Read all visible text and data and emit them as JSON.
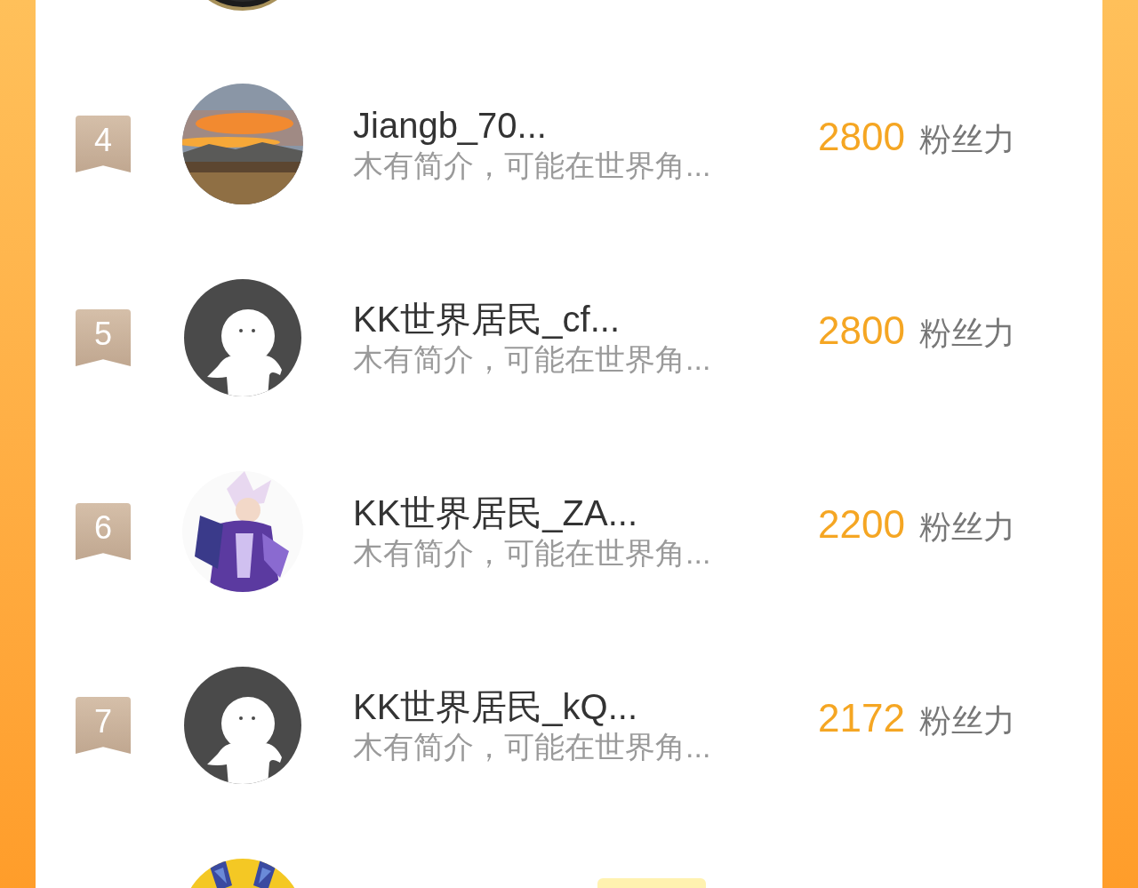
{
  "rows": [
    {
      "avatar": {
        "kind": "medal"
      }
    },
    {
      "rank": "4",
      "avatar": {
        "kind": "landscape"
      },
      "name": "Jiangb_70...",
      "intro": "木有简介，可能在世界角...",
      "score": "2800",
      "unit": "粉丝力"
    },
    {
      "rank": "5",
      "avatar": {
        "kind": "default"
      },
      "name": "KK世界居民_cf...",
      "intro": "木有简介，可能在世界角...",
      "score": "2800",
      "unit": "粉丝力"
    },
    {
      "rank": "6",
      "avatar": {
        "kind": "art"
      },
      "name": "KK世界居民_ZA...",
      "intro": "木有简介，可能在世界角...",
      "score": "2200",
      "unit": "粉丝力"
    },
    {
      "rank": "7",
      "avatar": {
        "kind": "default"
      },
      "name": "KK世界居民_kQ...",
      "intro": "木有简介，可能在世界角...",
      "score": "2172",
      "unit": "粉丝力"
    },
    {
      "avatar": {
        "kind": "butterfly"
      },
      "tag": true
    }
  ]
}
